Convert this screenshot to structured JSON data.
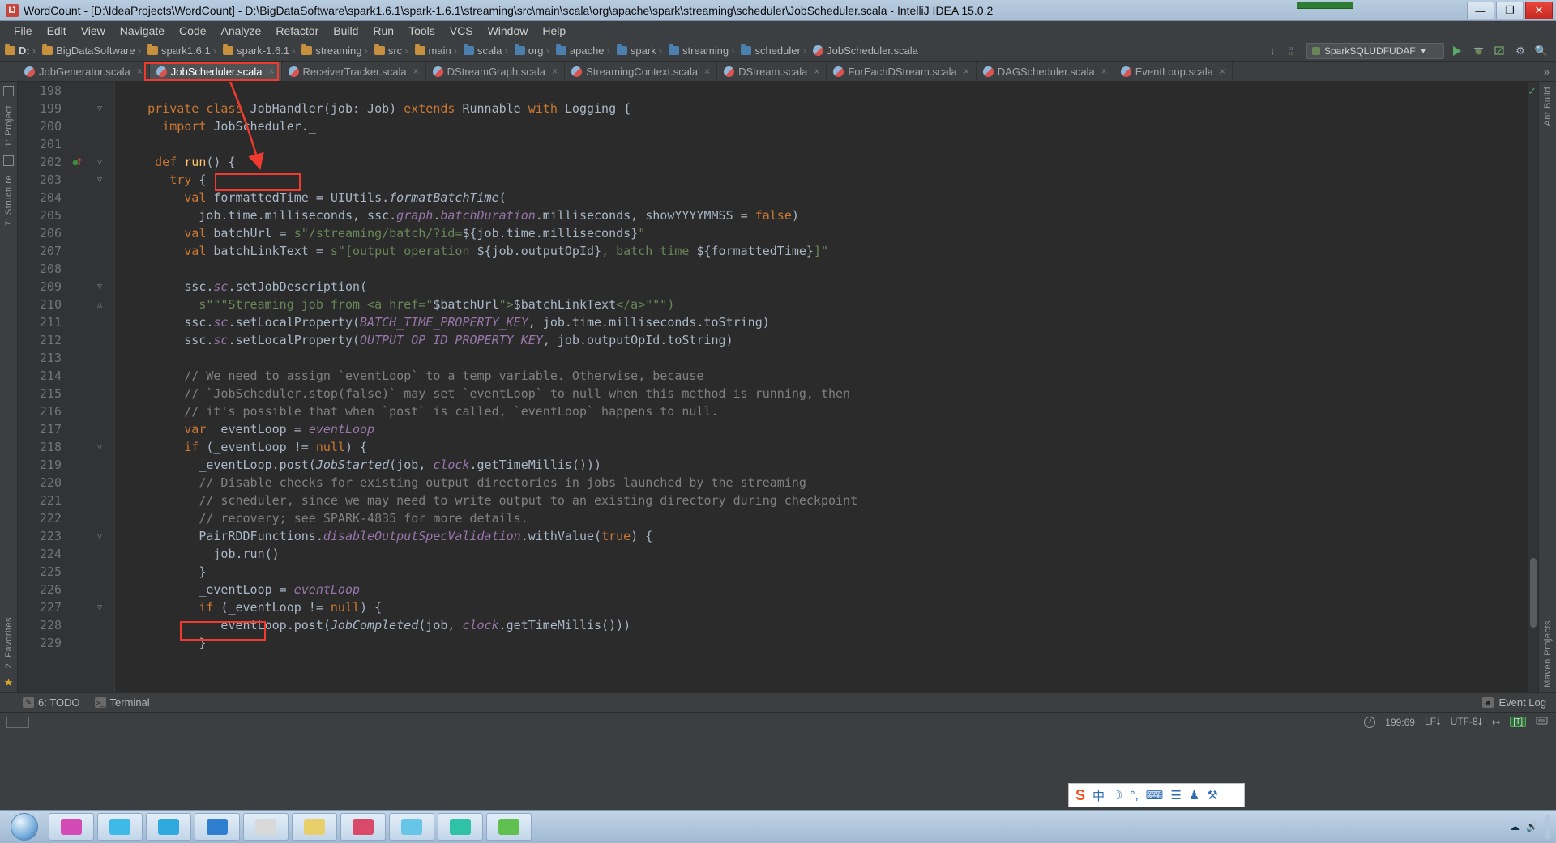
{
  "window": {
    "title": "WordCount - [D:\\IdeaProjects\\WordCount] - D:\\BigDataSoftware\\spark1.6.1\\spark-1.6.1\\streaming\\src\\main\\scala\\org\\apache\\spark\\streaming\\scheduler\\JobScheduler.scala - IntelliJ IDEA 15.0.2",
    "app_icon": "IJ",
    "minimize": "—",
    "maximize": "❐",
    "close": "✕"
  },
  "menu": {
    "items": [
      {
        "label": "File"
      },
      {
        "label": "Edit"
      },
      {
        "label": "View"
      },
      {
        "label": "Navigate"
      },
      {
        "label": "Code"
      },
      {
        "label": "Analyze"
      },
      {
        "label": "Refactor"
      },
      {
        "label": "Build"
      },
      {
        "label": "Run"
      },
      {
        "label": "Tools"
      },
      {
        "label": "VCS"
      },
      {
        "label": "Window"
      },
      {
        "label": "Help"
      }
    ]
  },
  "navbar": {
    "crumbs": [
      {
        "label": "D:",
        "icon": "folder-icon",
        "bold": true
      },
      {
        "label": "BigDataSoftware",
        "icon": "folder-icon"
      },
      {
        "label": "spark1.6.1",
        "icon": "folder-icon"
      },
      {
        "label": "spark-1.6.1",
        "icon": "folder-icon"
      },
      {
        "label": "streaming",
        "icon": "folder-icon"
      },
      {
        "label": "src",
        "icon": "folder-icon"
      },
      {
        "label": "main",
        "icon": "folder-icon"
      },
      {
        "label": "scala",
        "icon": "source-folder-icon"
      },
      {
        "label": "org",
        "icon": "source-folder-icon"
      },
      {
        "label": "apache",
        "icon": "source-folder-icon"
      },
      {
        "label": "spark",
        "icon": "source-folder-icon"
      },
      {
        "label": "streaming",
        "icon": "source-folder-icon"
      },
      {
        "label": "scheduler",
        "icon": "source-folder-icon"
      },
      {
        "label": "JobScheduler.scala",
        "icon": "scala-file-icon"
      }
    ],
    "separator": "›",
    "run_config": "SparkSQLUDFUDAF",
    "run_label": "run-button",
    "download_icon": "↓",
    "numbers_icon": "01\n10"
  },
  "tabs": {
    "items": [
      {
        "label": "JobGenerator.scala",
        "active": false
      },
      {
        "label": "JobScheduler.scala",
        "active": true
      },
      {
        "label": "ReceiverTracker.scala",
        "active": false
      },
      {
        "label": "DStreamGraph.scala",
        "active": false
      },
      {
        "label": "StreamingContext.scala",
        "active": false
      },
      {
        "label": "DStream.scala",
        "active": false
      },
      {
        "label": "ForEachDStream.scala",
        "active": false
      },
      {
        "label": "DAGScheduler.scala",
        "active": false
      },
      {
        "label": "EventLoop.scala",
        "active": false
      }
    ],
    "close_glyph": "×",
    "overflow_glyph": "»"
  },
  "rails": {
    "left": [
      {
        "label": "1: Project"
      },
      {
        "label": "7: Structure"
      },
      {
        "label": "2: Favorites"
      }
    ],
    "right": [
      {
        "label": "Ant Build"
      },
      {
        "label": "Maven Projects"
      }
    ]
  },
  "editor": {
    "first_line": 198,
    "lines": [
      {
        "n": 198,
        "fold": "",
        "mark": "",
        "tokens": []
      },
      {
        "n": 199,
        "fold": "▽",
        "mark": "",
        "tokens": [
          {
            "t": "    ",
            "c": "sb"
          },
          {
            "t": "private class ",
            "c": "k"
          },
          {
            "t": "JobHandler",
            "c": "sb"
          },
          {
            "t": "(job: Job) ",
            "c": "sb"
          },
          {
            "t": "extends ",
            "c": "k"
          },
          {
            "t": "Runnable ",
            "c": "sb"
          },
          {
            "t": "with ",
            "c": "k"
          },
          {
            "t": "Logging {",
            "c": "sb"
          }
        ]
      },
      {
        "n": 200,
        "fold": "",
        "mark": "",
        "tokens": [
          {
            "t": "      ",
            "c": "sb"
          },
          {
            "t": "import ",
            "c": "k"
          },
          {
            "t": "JobScheduler._",
            "c": "sb"
          }
        ]
      },
      {
        "n": 201,
        "fold": "",
        "mark": "",
        "tokens": []
      },
      {
        "n": 202,
        "fold": "▽",
        "mark": "override",
        "tokens": [
          {
            "t": "     ",
            "c": "sb"
          },
          {
            "t": "def ",
            "c": "k"
          },
          {
            "t": "run",
            "c": "f"
          },
          {
            "t": "() {",
            "c": "sb"
          }
        ]
      },
      {
        "n": 203,
        "fold": "▽",
        "mark": "",
        "tokens": [
          {
            "t": "       ",
            "c": "sb"
          },
          {
            "t": "try ",
            "c": "k"
          },
          {
            "t": "{",
            "c": "sb"
          }
        ]
      },
      {
        "n": 204,
        "fold": "",
        "mark": "",
        "tokens": [
          {
            "t": "         ",
            "c": "sb"
          },
          {
            "t": "val ",
            "c": "k"
          },
          {
            "t": "formattedTime = UIUtils.",
            "c": "sb"
          },
          {
            "t": "formatBatchTime",
            "c": "it"
          },
          {
            "t": "(",
            "c": "sb"
          }
        ]
      },
      {
        "n": 205,
        "fold": "",
        "mark": "",
        "tokens": [
          {
            "t": "           job.time.milliseconds, ssc.",
            "c": "sb"
          },
          {
            "t": "graph",
            "c": "fld"
          },
          {
            "t": ".",
            "c": "sb"
          },
          {
            "t": "batchDuration",
            "c": "fld"
          },
          {
            "t": ".milliseconds, showYYYYMMSS = ",
            "c": "sb"
          },
          {
            "t": "false",
            "c": "k"
          },
          {
            "t": ")",
            "c": "sb"
          }
        ]
      },
      {
        "n": 206,
        "fold": "",
        "mark": "",
        "tokens": [
          {
            "t": "         ",
            "c": "sb"
          },
          {
            "t": "val ",
            "c": "k"
          },
          {
            "t": "batchUrl = ",
            "c": "sb"
          },
          {
            "t": "s\"/streaming/batch/?id=",
            "c": "s"
          },
          {
            "t": "${job.time.milliseconds}",
            "c": "sb"
          },
          {
            "t": "\"",
            "c": "s"
          }
        ]
      },
      {
        "n": 207,
        "fold": "",
        "mark": "",
        "tokens": [
          {
            "t": "         ",
            "c": "sb"
          },
          {
            "t": "val ",
            "c": "k"
          },
          {
            "t": "batchLinkText = ",
            "c": "sb"
          },
          {
            "t": "s\"[output operation ",
            "c": "s"
          },
          {
            "t": "${job.outputOpId}",
            "c": "sb"
          },
          {
            "t": ", batch time ",
            "c": "s"
          },
          {
            "t": "${formattedTime}",
            "c": "sb"
          },
          {
            "t": "]\"",
            "c": "s"
          }
        ]
      },
      {
        "n": 208,
        "fold": "",
        "mark": "",
        "tokens": []
      },
      {
        "n": 209,
        "fold": "▽",
        "mark": "",
        "tokens": [
          {
            "t": "         ssc.",
            "c": "sb"
          },
          {
            "t": "sc",
            "c": "fld"
          },
          {
            "t": ".setJobDescription(",
            "c": "sb"
          }
        ]
      },
      {
        "n": 210,
        "fold": "△",
        "mark": "",
        "tokens": [
          {
            "t": "           ",
            "c": "sb"
          },
          {
            "t": "s\"\"\"Streaming job from <a href=\"",
            "c": "s"
          },
          {
            "t": "$batchUrl",
            "c": "sb"
          },
          {
            "t": "\">",
            "c": "s"
          },
          {
            "t": "$batchLinkText",
            "c": "sb"
          },
          {
            "t": "</a>\"\"\")",
            "c": "s"
          }
        ]
      },
      {
        "n": 211,
        "fold": "",
        "mark": "",
        "tokens": [
          {
            "t": "         ssc.",
            "c": "sb"
          },
          {
            "t": "sc",
            "c": "fld"
          },
          {
            "t": ".setLocalProperty(",
            "c": "sb"
          },
          {
            "t": "BATCH_TIME_PROPERTY_KEY",
            "c": "fld"
          },
          {
            "t": ", job.time.milliseconds.toString)",
            "c": "sb"
          }
        ]
      },
      {
        "n": 212,
        "fold": "",
        "mark": "",
        "tokens": [
          {
            "t": "         ssc.",
            "c": "sb"
          },
          {
            "t": "sc",
            "c": "fld"
          },
          {
            "t": ".setLocalProperty(",
            "c": "sb"
          },
          {
            "t": "OUTPUT_OP_ID_PROPERTY_KEY",
            "c": "fld"
          },
          {
            "t": ", job.outputOpId.toString)",
            "c": "sb"
          }
        ]
      },
      {
        "n": 213,
        "fold": "",
        "mark": "",
        "tokens": []
      },
      {
        "n": 214,
        "fold": "",
        "mark": "",
        "tokens": [
          {
            "t": "         ",
            "c": "sb"
          },
          {
            "t": "// We need to assign `eventLoop` to a temp variable. Otherwise, because",
            "c": "c"
          }
        ]
      },
      {
        "n": 215,
        "fold": "",
        "mark": "",
        "tokens": [
          {
            "t": "         ",
            "c": "sb"
          },
          {
            "t": "// `JobScheduler.stop(false)` may set `eventLoop` to null when this method is running, then",
            "c": "c"
          }
        ]
      },
      {
        "n": 216,
        "fold": "",
        "mark": "",
        "tokens": [
          {
            "t": "         ",
            "c": "sb"
          },
          {
            "t": "// it's possible that when `post` is called, `eventLoop` happens to null.",
            "c": "c"
          }
        ]
      },
      {
        "n": 217,
        "fold": "",
        "mark": "",
        "tokens": [
          {
            "t": "         ",
            "c": "sb"
          },
          {
            "t": "var ",
            "c": "k"
          },
          {
            "t": "_eventLoop = ",
            "c": "sb"
          },
          {
            "t": "eventLoop",
            "c": "fld"
          }
        ]
      },
      {
        "n": 218,
        "fold": "▽",
        "mark": "",
        "tokens": [
          {
            "t": "         ",
            "c": "sb"
          },
          {
            "t": "if ",
            "c": "k"
          },
          {
            "t": "(_eventLoop != ",
            "c": "sb"
          },
          {
            "t": "null",
            "c": "k"
          },
          {
            "t": ") {",
            "c": "sb"
          }
        ]
      },
      {
        "n": 219,
        "fold": "",
        "mark": "",
        "tokens": [
          {
            "t": "           _eventLoop.post(",
            "c": "sb"
          },
          {
            "t": "JobStarted",
            "c": "it"
          },
          {
            "t": "(job, ",
            "c": "sb"
          },
          {
            "t": "clock",
            "c": "fld"
          },
          {
            "t": ".getTimeMillis()))",
            "c": "sb"
          }
        ]
      },
      {
        "n": 220,
        "fold": "",
        "mark": "",
        "tokens": [
          {
            "t": "           ",
            "c": "sb"
          },
          {
            "t": "// Disable checks for existing output directories in jobs launched by the streaming",
            "c": "c"
          }
        ]
      },
      {
        "n": 221,
        "fold": "",
        "mark": "",
        "tokens": [
          {
            "t": "           ",
            "c": "sb"
          },
          {
            "t": "// scheduler, since we may need to write output to an existing directory during checkpoint",
            "c": "c"
          }
        ]
      },
      {
        "n": 222,
        "fold": "",
        "mark": "",
        "tokens": [
          {
            "t": "           ",
            "c": "sb"
          },
          {
            "t": "// recovery; see SPARK-4835 for more details.",
            "c": "c"
          }
        ]
      },
      {
        "n": 223,
        "fold": "▽",
        "mark": "",
        "tokens": [
          {
            "t": "           PairRDDFunctions.",
            "c": "sb"
          },
          {
            "t": "disableOutputSpecValidation",
            "c": "fld"
          },
          {
            "t": ".withValue(",
            "c": "sb"
          },
          {
            "t": "true",
            "c": "k"
          },
          {
            "t": ") {",
            "c": "sb"
          }
        ]
      },
      {
        "n": 224,
        "fold": "",
        "mark": "",
        "tokens": [
          {
            "t": "             job.run()",
            "c": "sb"
          }
        ]
      },
      {
        "n": 225,
        "fold": "",
        "mark": "",
        "tokens": [
          {
            "t": "           }",
            "c": "sb"
          }
        ]
      },
      {
        "n": 226,
        "fold": "",
        "mark": "",
        "tokens": [
          {
            "t": "           _eventLoop = ",
            "c": "sb"
          },
          {
            "t": "eventLoop",
            "c": "fld"
          }
        ]
      },
      {
        "n": 227,
        "fold": "▽",
        "mark": "",
        "tokens": [
          {
            "t": "           ",
            "c": "sb"
          },
          {
            "t": "if ",
            "c": "k"
          },
          {
            "t": "(_eventLoop != ",
            "c": "sb"
          },
          {
            "t": "null",
            "c": "k"
          },
          {
            "t": ") {",
            "c": "sb"
          }
        ]
      },
      {
        "n": 228,
        "fold": "",
        "mark": "",
        "tokens": [
          {
            "t": "             _eventLoop.post(",
            "c": "sb"
          },
          {
            "t": "JobCompleted",
            "c": "it"
          },
          {
            "t": "(job, ",
            "c": "sb"
          },
          {
            "t": "clock",
            "c": "fld"
          },
          {
            "t": ".getTimeMillis()))",
            "c": "sb"
          }
        ]
      },
      {
        "n": 229,
        "fold": "",
        "mark": "",
        "tokens": [
          {
            "t": "           }",
            "c": "sb"
          }
        ]
      }
    ],
    "annotations": {
      "handler_box": "JobHandler",
      "jobrun_box": "job.run()",
      "arrow": "tab-to-class-arrow"
    }
  },
  "toolwindows": {
    "items": [
      {
        "label": "6: TODO",
        "icon": "todo-icon",
        "mnemonic": "6"
      },
      {
        "label": "Terminal",
        "icon": "terminal-icon"
      }
    ],
    "event_log": "Event Log",
    "event_log_icon": "balloon-icon"
  },
  "statusbar": {
    "position": "199:69",
    "line_separator": "LF⭣",
    "encoding": "UTF-8⭣",
    "indent_icon": "↦",
    "lock_icon": "lock-icon",
    "scheme_badge": "[T]",
    "memory_icon": "memory-icon"
  },
  "taskbar": {
    "start": "start-orb",
    "items": [
      {
        "name": "taskbar-item-1",
        "color": "#d44ab5"
      },
      {
        "name": "taskbar-item-2",
        "color": "#3fb9e8"
      },
      {
        "name": "taskbar-item-3",
        "color": "#2fa8dd"
      },
      {
        "name": "taskbar-item-4",
        "color": "#2f7fd0"
      },
      {
        "name": "taskbar-item-5",
        "color": "#d9d9d9"
      },
      {
        "name": "taskbar-item-6",
        "color": "#e8cf6a"
      },
      {
        "name": "taskbar-item-7",
        "color": "#d94a6a"
      },
      {
        "name": "taskbar-item-8",
        "color": "#67c6e8"
      },
      {
        "name": "taskbar-item-9",
        "color": "#2fc2a8"
      },
      {
        "name": "taskbar-item-10",
        "color": "#5fbf4f"
      }
    ]
  },
  "ime": {
    "logo": "S",
    "mode": "中",
    "moon": "☽",
    "punct": "°,",
    "keyboard": "⌨",
    "user": "☰",
    "shirt": "♟",
    "tools": "⚒"
  },
  "colors": {
    "accent_red": "#f03a2e",
    "keyword": "#cc7832",
    "string": "#6a8759",
    "comment": "#808080",
    "field": "#9876aa",
    "default_text": "#a9b7c6",
    "editor_bg": "#2b2b2b",
    "chrome_bg": "#3c3f41"
  }
}
